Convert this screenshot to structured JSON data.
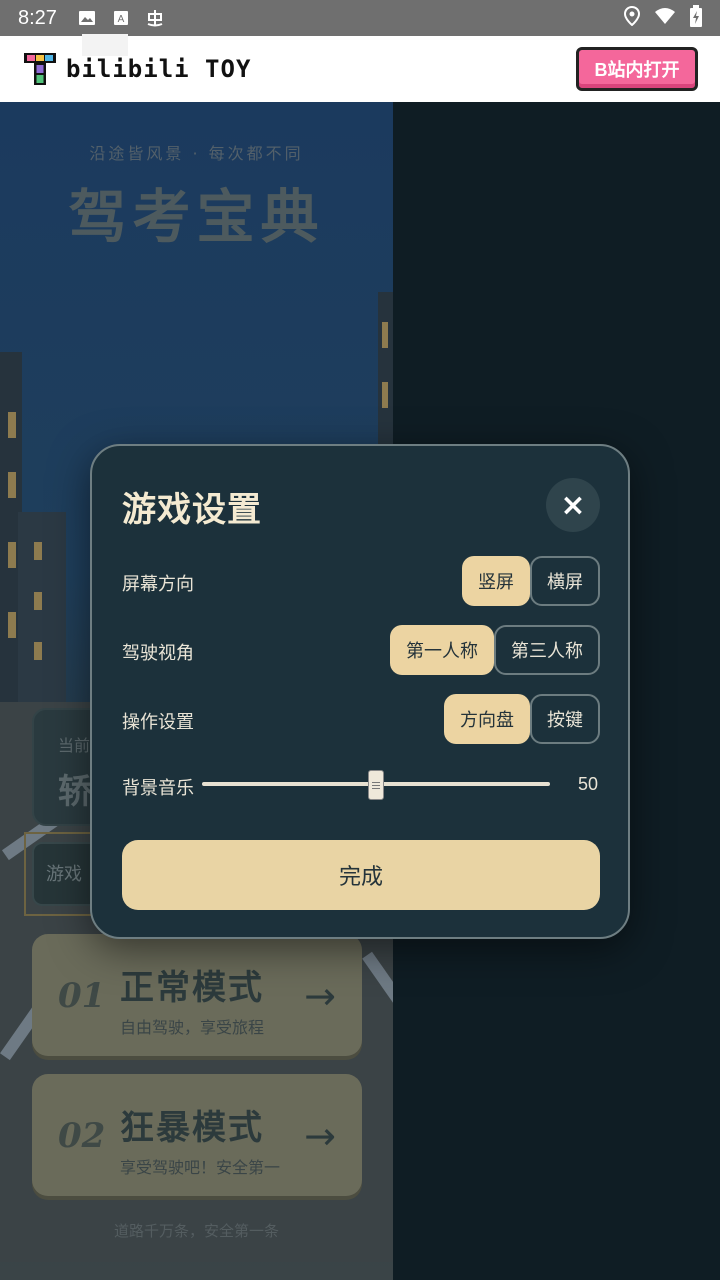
{
  "status_bar": {
    "time": "8:27",
    "left_icons": [
      "image-icon",
      "text-a-icon",
      "chinese-char-icon"
    ],
    "right_icons": [
      "location-icon",
      "wifi-icon",
      "battery-icon"
    ]
  },
  "header": {
    "logo_text": "bilibili TOY",
    "open_button": "B站内打开"
  },
  "game": {
    "subtitle": "沿途皆风景 · 每次都不同",
    "title": "驾考宝典",
    "info_small": "当前",
    "info_big": "轿",
    "settings_strip": "游戏",
    "modes": [
      {
        "num": "01",
        "title": "正常模式",
        "desc": "自由驾驶，享受旅程",
        "arrow": "→"
      },
      {
        "num": "02",
        "title": "狂暴模式",
        "desc": "享受驾驶吧！安全第一",
        "arrow": "→"
      }
    ],
    "footer": "道路千万条，安全第一条"
  },
  "dialog": {
    "title": "游戏设置",
    "close_symbol": "×",
    "rows": [
      {
        "label": "屏幕方向",
        "options": [
          "竖屏",
          "横屏"
        ],
        "selected": "竖屏"
      },
      {
        "label": "驾驶视角",
        "options": [
          "第一人称",
          "第三人称"
        ],
        "selected": "第一人称"
      },
      {
        "label": "操作设置",
        "options": [
          "方向盘",
          "按键"
        ],
        "selected": "方向盘"
      }
    ],
    "music_label": "背景音乐",
    "music_value": "50",
    "music_level": 0.5,
    "done_label": "完成"
  },
  "colors": {
    "accent": "#ecd4a2",
    "dialog_bg": "#1c313b",
    "open_button": "#f4679b"
  }
}
